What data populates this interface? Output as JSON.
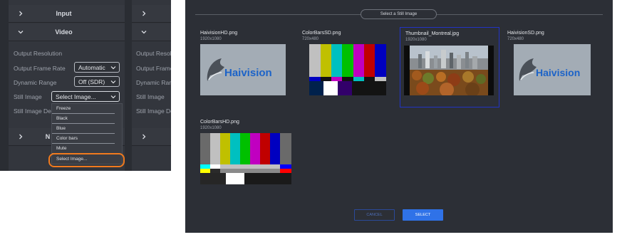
{
  "left_panel": {
    "sections": {
      "input": {
        "label": "Input",
        "icon": "chevron-right-icon"
      },
      "video": {
        "label": "Video",
        "icon": "chevron-down-icon"
      }
    },
    "fields": [
      {
        "label": "Output Resolution"
      },
      {
        "label": "Output Frame Rate",
        "value": "Automatic"
      },
      {
        "label": "Dynamic Range",
        "value": "Off (SDR)"
      },
      {
        "label": "Still Image",
        "value": "Select Image..."
      },
      {
        "label": "Still Image De"
      }
    ],
    "dropdown_options": [
      "Freeze",
      "Black",
      "Blue",
      "Color bars",
      "Mute",
      "Select Image..."
    ],
    "next_section_label": "N",
    "second_column_labels": [
      "Output Resolu",
      "Output Frame",
      "Dynamic Rang",
      "Still Image",
      "Still Image De"
    ],
    "highlight_color": "#f07a1e"
  },
  "dialog": {
    "title": "Select a Still Image",
    "images": [
      {
        "name": "HaivisionHD.png",
        "dims": "1920x1080",
        "kind": "haivision-logo"
      },
      {
        "name": "ColorBarsSD.png",
        "dims": "720x480",
        "kind": "color-bars"
      },
      {
        "name": "Thumbnail_Montreal.jpg",
        "dims": "1920x1080",
        "kind": "city-photo",
        "selected": true
      },
      {
        "name": "HaivisionSD.png",
        "dims": "720x480",
        "kind": "haivision-logo"
      },
      {
        "name": "ColorBarsHD.png",
        "dims": "1920x1080",
        "kind": "color-bars"
      }
    ],
    "logo_text": "Haivision",
    "buttons": {
      "cancel": "CANCEL",
      "select": "SELECT"
    },
    "colors": {
      "select_button": "#2f72e8",
      "selected_border": "#2234c4",
      "background": "#2c2f36"
    }
  }
}
